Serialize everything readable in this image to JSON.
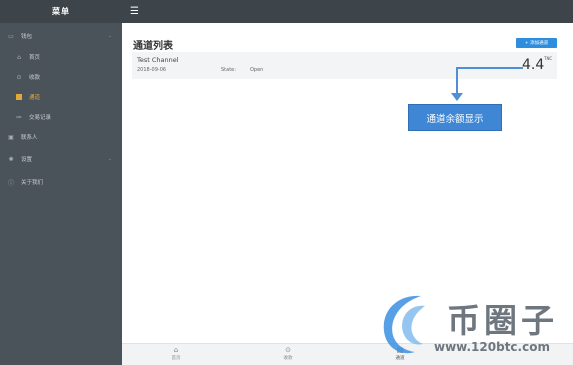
{
  "sidebar": {
    "title": "菜单",
    "items": [
      {
        "label": "钱包",
        "icon": "wallet-icon",
        "chevron": "⌄"
      },
      {
        "label": "首页",
        "icon": "home-icon"
      },
      {
        "label": "收款",
        "icon": "receive-icon"
      },
      {
        "label": "通道",
        "icon": "channel-icon",
        "active": true
      },
      {
        "label": "交易记录",
        "icon": "list-icon"
      },
      {
        "label": "联系人",
        "icon": "contacts-icon"
      },
      {
        "label": "设置",
        "icon": "gear-icon",
        "chevron": "⌄"
      },
      {
        "label": "关于我们",
        "icon": "info-icon"
      }
    ]
  },
  "topbar": {
    "menu_icon": "☰"
  },
  "main": {
    "title": "通道列表",
    "add_button": "+ 添加通道",
    "channel": {
      "name": "Test Channel",
      "date": "2018-09-06",
      "state_label": "State:",
      "state_value": "Open",
      "amount": "4.4",
      "unit": "TNC"
    }
  },
  "annotation": {
    "text": "通道余额显示"
  },
  "tabbar": {
    "tabs": [
      {
        "label": "首页",
        "icon": "⌂"
      },
      {
        "label": "收款",
        "icon": "⊙"
      },
      {
        "label": "通道",
        "icon": "▤",
        "active": true
      }
    ]
  },
  "watermark": {
    "brand": "币圈子",
    "url": "www.120btc.com"
  },
  "colors": {
    "sidebar": "#4b535a",
    "topbar": "#3d444a",
    "accent": "#2f8ddd",
    "active": "#e0a93a",
    "annotation": "#3f86d4"
  }
}
